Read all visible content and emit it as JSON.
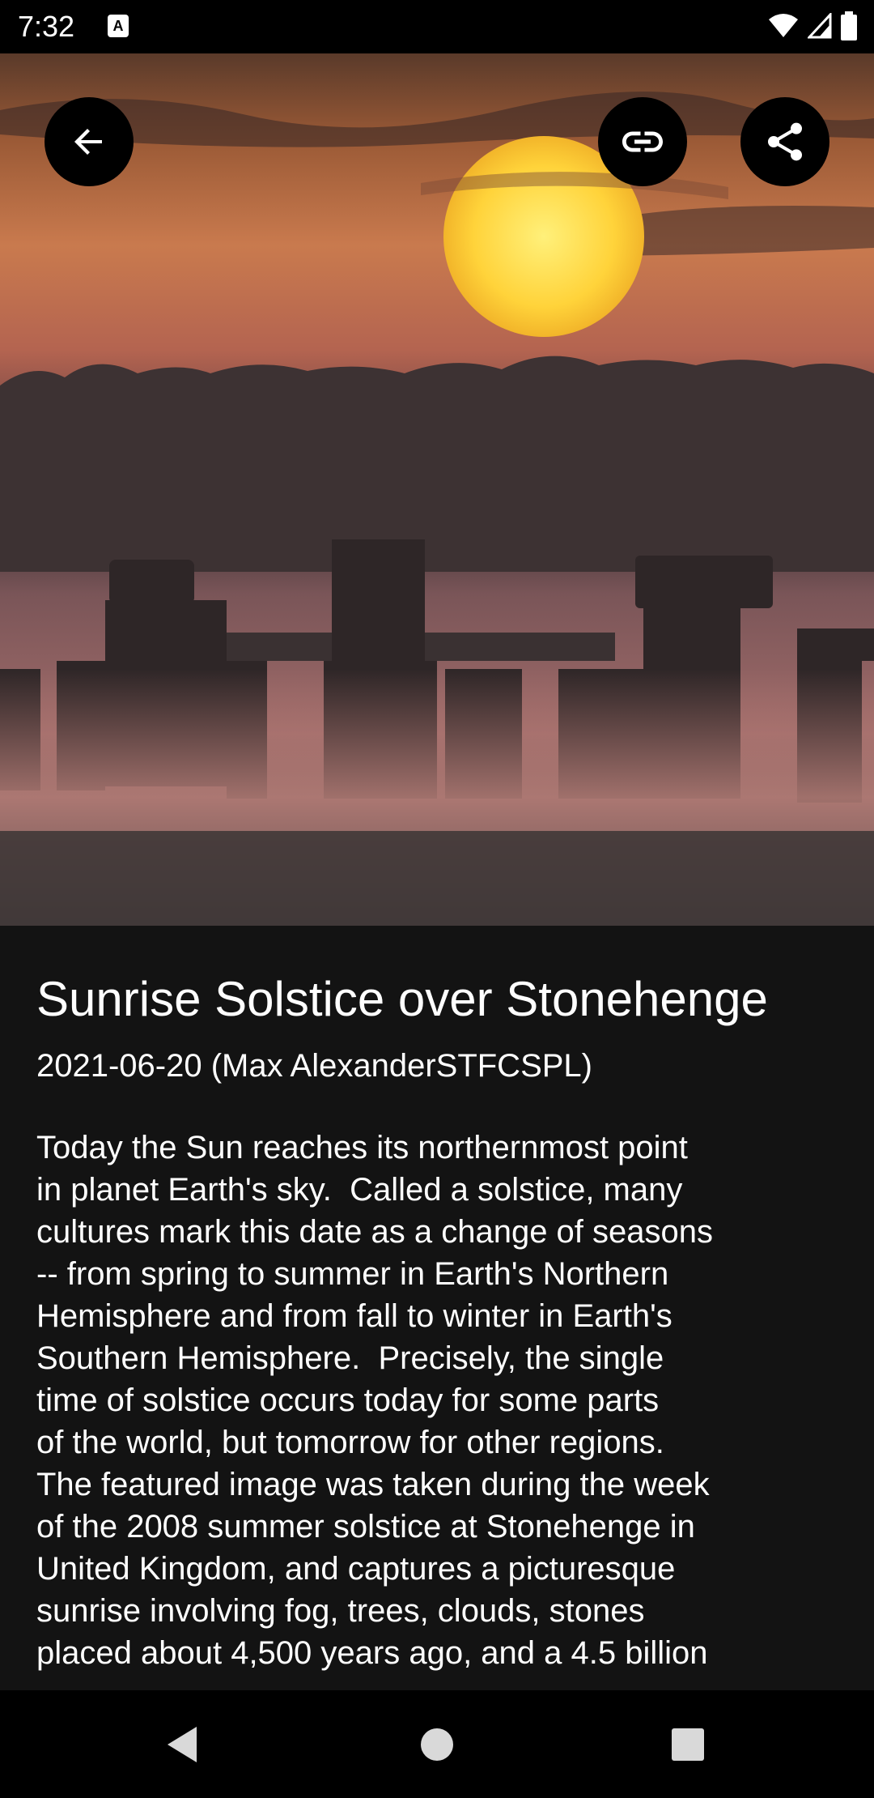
{
  "status_bar": {
    "time": "7:32",
    "notification_icon": "A-icon",
    "icons": [
      "wifi-icon",
      "signal-icon",
      "battery-icon"
    ]
  },
  "toolbar": {
    "back_icon": "arrow-back-icon",
    "link_icon": "link-icon",
    "share_icon": "share-icon"
  },
  "article": {
    "title": "Sunrise Solstice over Stonehenge",
    "date_credit": "2021-06-20 (Max AlexanderSTFCSPL)",
    "body": "Today the Sun reaches its northernmost point\nin planet Earth's sky.  Called a solstice, many\ncultures mark this date as a change of seasons\n-- from spring to summer in Earth's Northern\nHemisphere and from fall to winter in Earth's\nSouthern Hemisphere.  Precisely, the single\ntime of solstice occurs today for some parts\nof the world, but tomorrow for other regions.\nThe featured image was taken during the week\nof the 2008 summer solstice at Stonehenge in\nUnited Kingdom, and captures a picturesque\nsunrise involving fog, trees, clouds, stones\nplaced about 4,500 years ago, and a 4.5 billion"
  },
  "nav_bar": {
    "back": "nav-back-icon",
    "home": "nav-home-icon",
    "recents": "nav-recents-icon"
  }
}
